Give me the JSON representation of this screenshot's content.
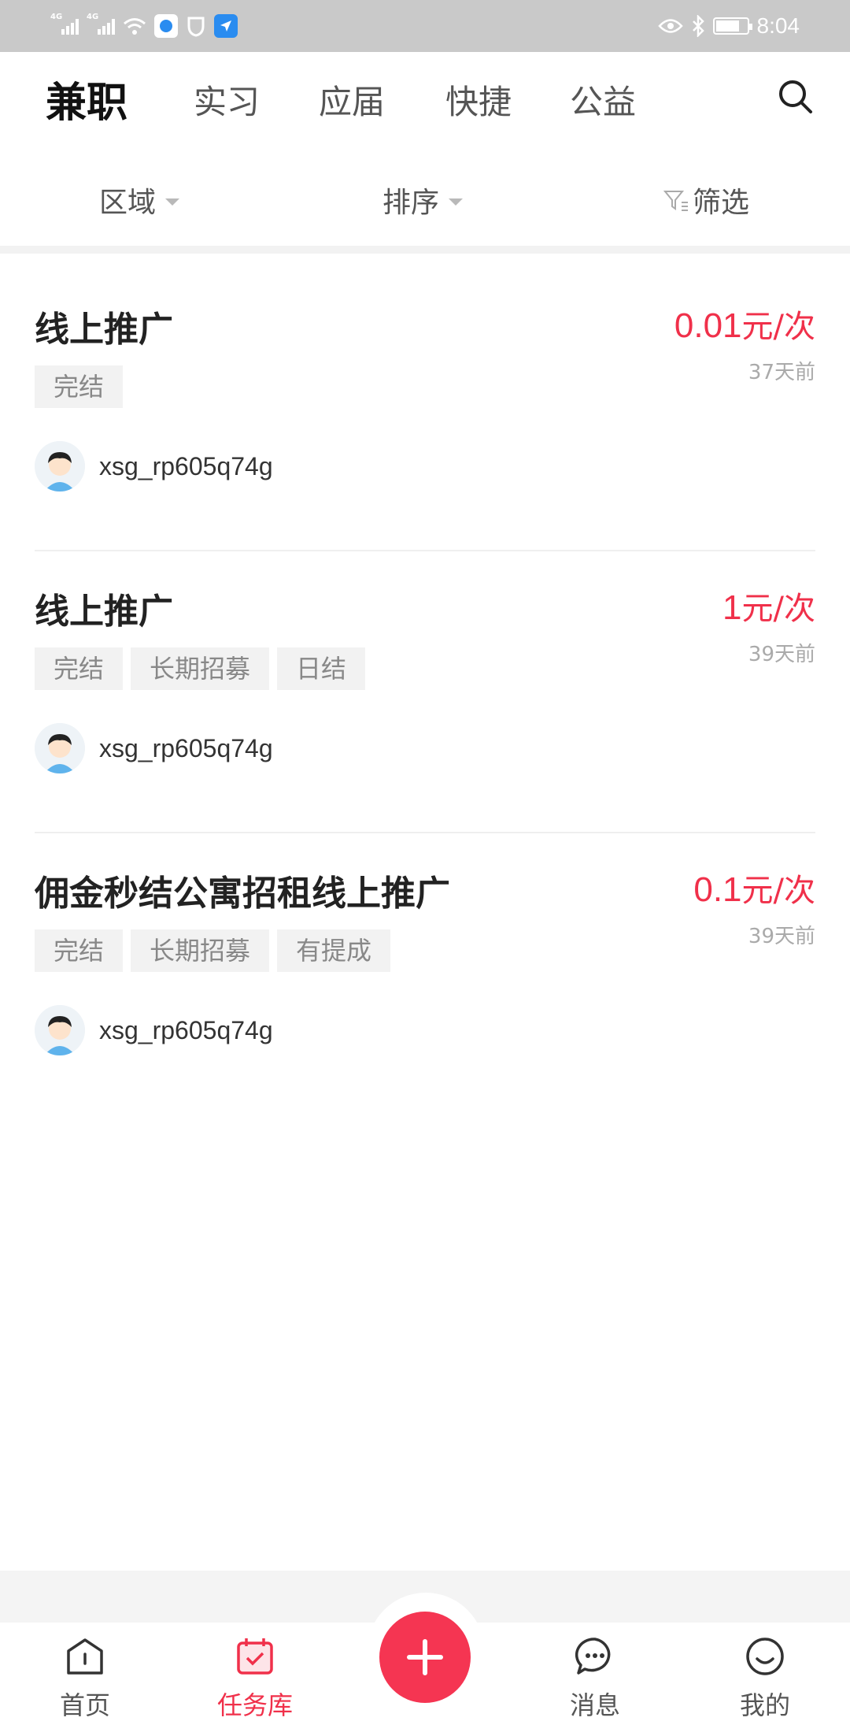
{
  "status_bar": {
    "time": "8:04",
    "net1": "4G",
    "net2": "4G"
  },
  "top_tabs": [
    {
      "label": "兼职",
      "active": true
    },
    {
      "label": "实习",
      "active": false
    },
    {
      "label": "应届",
      "active": false
    },
    {
      "label": "快捷",
      "active": false
    },
    {
      "label": "公益",
      "active": false
    }
  ],
  "search": {
    "icon": "search-icon"
  },
  "filters": {
    "area": "区域",
    "sort": "排序",
    "filter": "筛选"
  },
  "jobs": [
    {
      "title": "线上推广",
      "price": "0.01",
      "unit": "元/次",
      "time": "37天前",
      "tags": [
        "完结"
      ],
      "owner": "xsg_rp605q74g"
    },
    {
      "title": "线上推广",
      "price": "1",
      "unit": "元/次",
      "time": "39天前",
      "tags": [
        "完结",
        "长期招募",
        "日结"
      ],
      "owner": "xsg_rp605q74g"
    },
    {
      "title": "佣金秒结公寓招租线上推广",
      "price": "0.1",
      "unit": "元/次",
      "time": "39天前",
      "tags": [
        "完结",
        "长期招募",
        "有提成"
      ],
      "owner": "xsg_rp605q74g"
    }
  ],
  "bottom_nav": {
    "home": "首页",
    "tasks": "任务库",
    "messages": "消息",
    "mine": "我的",
    "active": "tasks"
  },
  "colors": {
    "accent": "#f0304a",
    "add_button": "#f53552"
  }
}
